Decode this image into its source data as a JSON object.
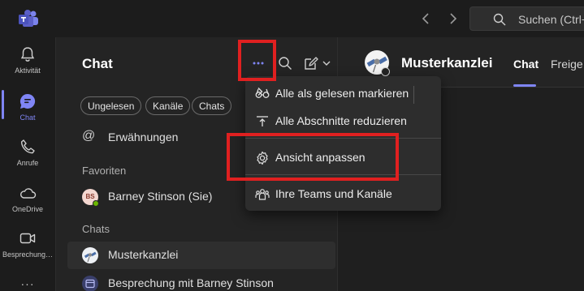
{
  "topbar": {
    "search_placeholder": "Suchen (Ctrl+"
  },
  "rail": {
    "items": [
      {
        "label": "Aktivität",
        "icon": "bell-icon"
      },
      {
        "label": "Chat",
        "icon": "chat-icon"
      },
      {
        "label": "Anrufe",
        "icon": "phone-icon"
      },
      {
        "label": "OneDrive",
        "icon": "cloud-icon"
      },
      {
        "label": "Besprechung…",
        "icon": "video-icon"
      }
    ],
    "more": "···"
  },
  "chat_pane": {
    "title": "Chat",
    "filters": [
      "Ungelesen",
      "Kanäle",
      "Chats"
    ],
    "mentions_label": "Erwähnungen",
    "favorites_header": "Favoriten",
    "favorites": [
      {
        "name": "Barney Stinson (Sie)",
        "initials": "BS"
      }
    ],
    "chats_header": "Chats",
    "chats": [
      {
        "name": "Musterkanzlei"
      },
      {
        "name": "Besprechung mit Barney Stinson"
      }
    ]
  },
  "main": {
    "title": "Musterkanzlei",
    "tabs": [
      "Chat",
      "Freige"
    ]
  },
  "menu": {
    "items": [
      {
        "label": "Alle als gelesen markieren",
        "icon": "glasses-icon"
      },
      {
        "label": "Alle Abschnitte reduzieren",
        "icon": "collapse-icon"
      },
      {
        "label": "Ansicht anpassen",
        "icon": "gear-icon"
      },
      {
        "label": "Ihre Teams und Kanäle",
        "icon": "teams-icon"
      }
    ]
  },
  "colors": {
    "accent": "#7f85f5",
    "highlight": "#e02020"
  }
}
